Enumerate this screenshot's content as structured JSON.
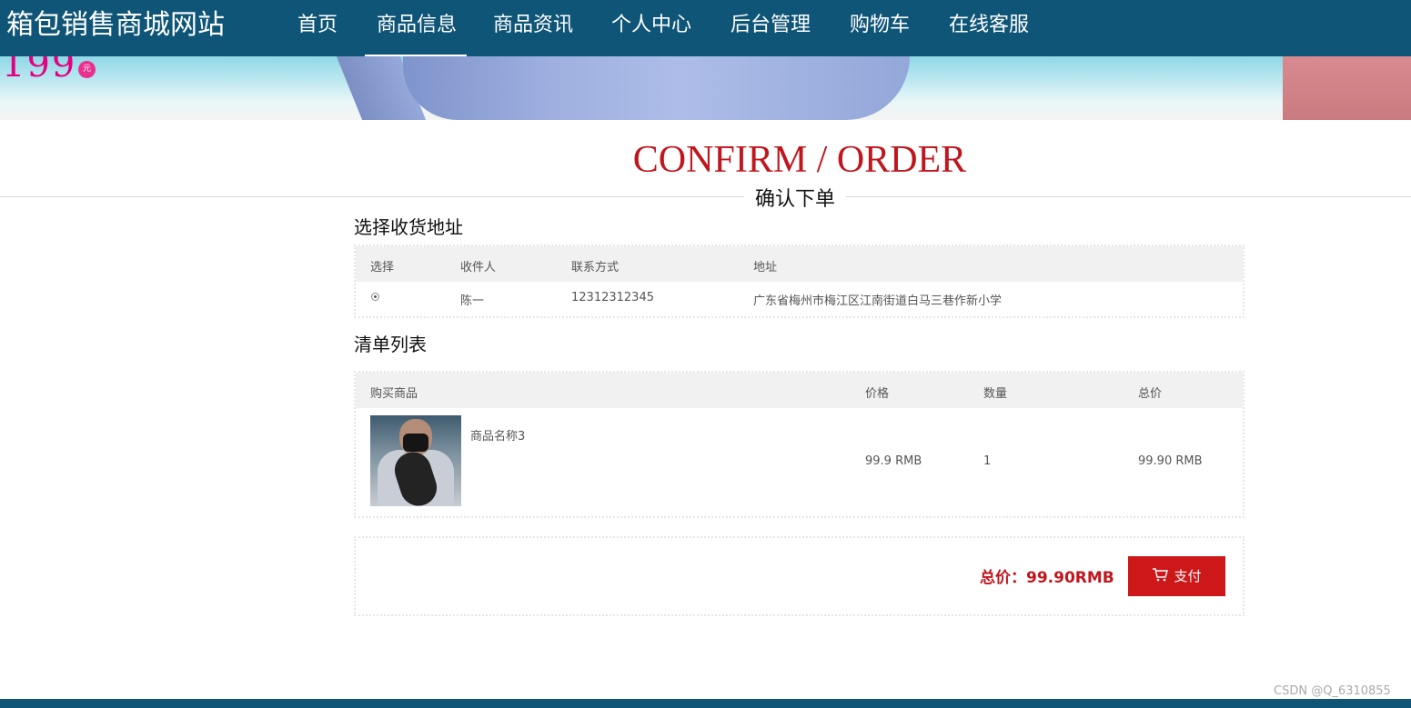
{
  "header": {
    "brand": "箱包销售商城网站",
    "nav": [
      {
        "label": "首页"
      },
      {
        "label": "商品信息",
        "active": true
      },
      {
        "label": "商品资讯"
      },
      {
        "label": "个人中心"
      },
      {
        "label": "后台管理"
      },
      {
        "label": "购物车"
      },
      {
        "label": "在线客服"
      }
    ]
  },
  "banner": {
    "price_text": "199",
    "yuan": "元"
  },
  "page": {
    "title": "CONFIRM / ORDER",
    "subtitle": "确认下单"
  },
  "address": {
    "section_title": "选择收货地址",
    "headers": [
      "选择",
      "收件人",
      "联系方式",
      "地址"
    ],
    "rows": [
      {
        "selected": true,
        "recipient": "陈一",
        "phone": "12312312345",
        "address": "广东省梅州市梅江区江南街道白马三巷作新小学"
      }
    ]
  },
  "order": {
    "section_title": "清单列表",
    "headers": [
      "购买商品",
      "价格",
      "数量",
      "总价"
    ],
    "items": [
      {
        "name": "商品名称3",
        "price": "99.9 RMB",
        "qty": "1",
        "total": "99.90 RMB",
        "image_icon": "product-photo-icon"
      }
    ]
  },
  "summary": {
    "total": "总价：99.90RMB",
    "pay_label": "支付",
    "pay_icon": "cart-icon"
  },
  "watermark": "CSDN @Q_6310855",
  "colors": {
    "nav_bg": "#0f5577",
    "accent_red": "#c0161e",
    "pay_red": "#cd1719"
  }
}
